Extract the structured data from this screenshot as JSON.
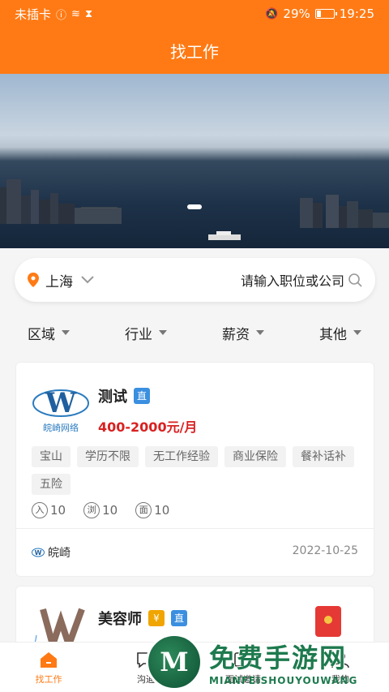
{
  "status_bar": {
    "carrier": "未插卡",
    "battery_pct": "29%",
    "battery_level": 0.29,
    "time": "19:25"
  },
  "header": {
    "title": "找工作"
  },
  "search": {
    "city": "上海",
    "placeholder": "请输入职位或公司"
  },
  "filters": [
    "区域",
    "行业",
    "薪资",
    "其他"
  ],
  "jobs": [
    {
      "title": "测试",
      "badge": "直",
      "salary": "400-2000元/月",
      "logo_text": "W",
      "logo_caption": "皖崎网络",
      "tags": [
        "宝山",
        "学历不限",
        "无工作经验",
        "商业保险",
        "餐补话补",
        "五险"
      ],
      "stats": [
        {
          "icon": "入",
          "value": "10"
        },
        {
          "icon": "浏",
          "value": "10"
        },
        {
          "icon": "面",
          "value": "10"
        }
      ],
      "company": "皖崎",
      "date": "2022-10-25"
    },
    {
      "title": "美容师",
      "badge_yen": "¥",
      "badge": "直"
    }
  ],
  "tabbar": [
    "找工作",
    "沟通",
    "面试邀请",
    "我的"
  ],
  "watermark": {
    "title": "免费手游网",
    "sub": "MIANFEISHOUYOUWANG"
  },
  "colors": {
    "accent": "#ff7a14",
    "salary": "#d92121",
    "badge_direct": "#3b8fe0"
  }
}
